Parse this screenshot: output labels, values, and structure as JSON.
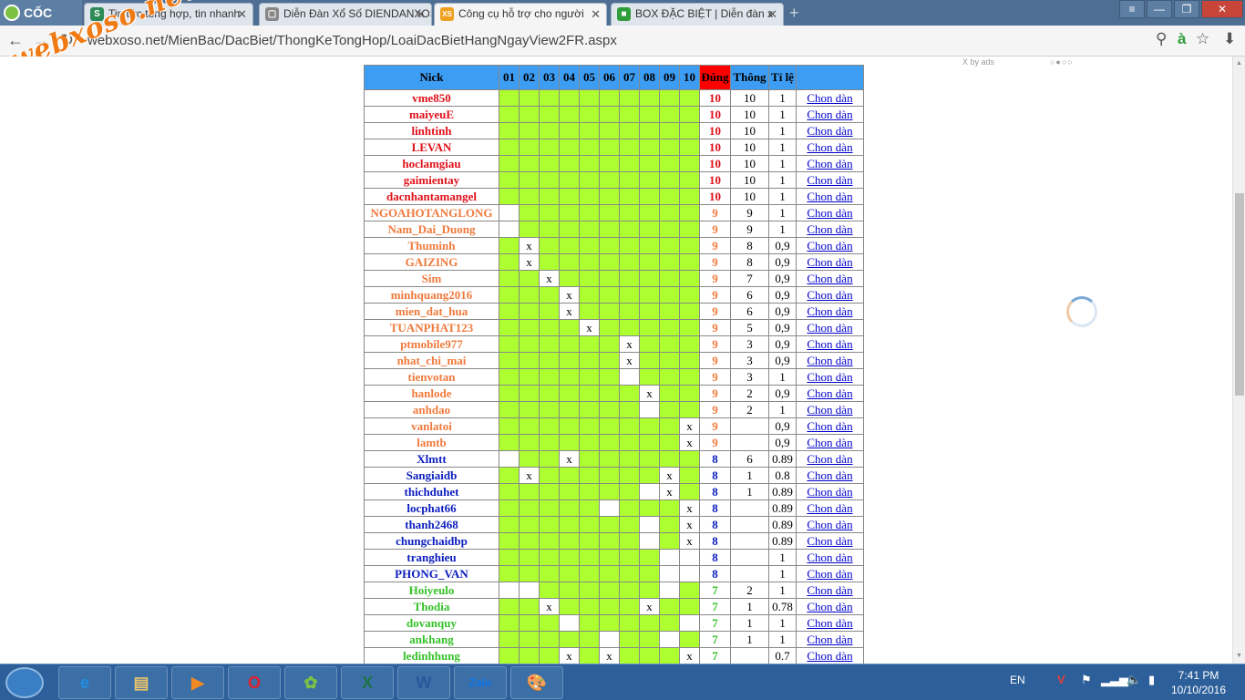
{
  "browser": {
    "logo_text": "CỐC CỐC",
    "tabs": [
      {
        "label": "Tin tức tổng hợp, tin nhanh",
        "favicon": "S",
        "favicon_color": "#2e8b57"
      },
      {
        "label": "Diễn Đàn Xổ Số DIENDANXOSO",
        "favicon": "▢",
        "favicon_color": "#888888"
      },
      {
        "label": "Công cụ hỗ trợ cho người",
        "favicon": "XS",
        "favicon_color": "#f0a020"
      },
      {
        "label": "BOX ĐẶC BIỆT | Diễn đàn x",
        "favicon": "■",
        "favicon_color": "#2e9d3a"
      }
    ],
    "new_tab": "+",
    "window_buttons": {
      "menu": "≡",
      "minimize": "—",
      "restore": "❐",
      "close": "✕"
    },
    "url": "http://webxoso.net/MienBac/DacBiet/ThongKeTongHop/LoaiDacBietHangNgayView2FR.aspx",
    "url_display": "webxoso.net/MienBac/DacBiet/ThongKeTongHop/LoaiDacBietHangNgayView2FR.aspx",
    "nav": {
      "back": "←",
      "forward": "→",
      "reload": "↻"
    },
    "toolbar_icons": {
      "search": "⚲",
      "translate": "à",
      "star": "☆",
      "download": "⬇"
    }
  },
  "watermark": "webxoso.net",
  "ads": {
    "label": "X by ads",
    "dots": "○●○○"
  },
  "table": {
    "headers": {
      "nick": "Nick",
      "days": [
        "01",
        "02",
        "03",
        "04",
        "05",
        "06",
        "07",
        "08",
        "09",
        "10"
      ],
      "dung": "Đúng",
      "thong": "Thông",
      "tile": "Tỉ lệ",
      "chon": ""
    },
    "colors": {
      "red": "#e0101a",
      "orange": "#f07a3c",
      "blue": "#0b1dbe",
      "green": "#35c128",
      "grid_green": "#adff2f",
      "header_blue": "#3d9df3",
      "header_red": "#ff0000"
    },
    "rows": [
      {
        "nick": "vme850",
        "color": "red",
        "off": [],
        "x": [],
        "dung": "10",
        "thong": "10",
        "tile": "1",
        "chon": "Chon dàn"
      },
      {
        "nick": "maiyeuE",
        "color": "red",
        "off": [],
        "x": [],
        "dung": "10",
        "thong": "10",
        "tile": "1",
        "chon": "Chon dàn"
      },
      {
        "nick": "linhtinh",
        "color": "red",
        "off": [],
        "x": [],
        "dung": "10",
        "thong": "10",
        "tile": "1",
        "chon": "Chon dàn"
      },
      {
        "nick": "LEVAN",
        "color": "red",
        "off": [],
        "x": [],
        "dung": "10",
        "thong": "10",
        "tile": "1",
        "chon": "Chon dàn"
      },
      {
        "nick": "hoclamgiau",
        "color": "red",
        "off": [],
        "x": [],
        "dung": "10",
        "thong": "10",
        "tile": "1",
        "chon": "Chon dàn"
      },
      {
        "nick": "gaimientay",
        "color": "red",
        "off": [],
        "x": [],
        "dung": "10",
        "thong": "10",
        "tile": "1",
        "chon": "Chon dàn"
      },
      {
        "nick": "dacnhantamangel",
        "color": "red",
        "off": [],
        "x": [],
        "dung": "10",
        "thong": "10",
        "tile": "1",
        "chon": "Chon dàn"
      },
      {
        "nick": "NGOAHOTANGLONG",
        "color": "orange",
        "off": [
          0
        ],
        "x": [],
        "dung": "9",
        "thong": "9",
        "tile": "1",
        "chon": "Chon dàn"
      },
      {
        "nick": "Nam_Dai_Duong",
        "color": "orange",
        "off": [
          0
        ],
        "x": [],
        "dung": "9",
        "thong": "9",
        "tile": "1",
        "chon": "Chon dàn"
      },
      {
        "nick": "Thuminh",
        "color": "orange",
        "off": [],
        "x": [
          1
        ],
        "dung": "9",
        "thong": "8",
        "tile": "0,9",
        "chon": "Chon dàn"
      },
      {
        "nick": "GAIZING",
        "color": "orange",
        "off": [],
        "x": [
          1
        ],
        "dung": "9",
        "thong": "8",
        "tile": "0,9",
        "chon": "Chon dàn"
      },
      {
        "nick": "Sim",
        "color": "orange",
        "off": [],
        "x": [
          2
        ],
        "dung": "9",
        "thong": "7",
        "tile": "0,9",
        "chon": "Chon dàn"
      },
      {
        "nick": "minhquang2016",
        "color": "orange",
        "off": [],
        "x": [
          3
        ],
        "dung": "9",
        "thong": "6",
        "tile": "0,9",
        "chon": "Chon dàn"
      },
      {
        "nick": "mien_dat_hua",
        "color": "orange",
        "off": [],
        "x": [
          3
        ],
        "dung": "9",
        "thong": "6",
        "tile": "0,9",
        "chon": "Chon dàn"
      },
      {
        "nick": "TUANPHAT123",
        "color": "orange",
        "off": [],
        "x": [
          4
        ],
        "dung": "9",
        "thong": "5",
        "tile": "0,9",
        "chon": "Chon dàn"
      },
      {
        "nick": "ptmobile977",
        "color": "orange",
        "off": [],
        "x": [
          6
        ],
        "dung": "9",
        "thong": "3",
        "tile": "0,9",
        "chon": "Chon dàn"
      },
      {
        "nick": "nhat_chi_mai",
        "color": "orange",
        "off": [],
        "x": [
          6
        ],
        "dung": "9",
        "thong": "3",
        "tile": "0,9",
        "chon": "Chon dàn"
      },
      {
        "nick": "tienvotan",
        "color": "orange",
        "off": [
          6
        ],
        "x": [],
        "dung": "9",
        "thong": "3",
        "tile": "1",
        "chon": "Chon dàn"
      },
      {
        "nick": "hanlode",
        "color": "orange",
        "off": [],
        "x": [
          7
        ],
        "dung": "9",
        "thong": "2",
        "tile": "0,9",
        "chon": "Chon dàn"
      },
      {
        "nick": "anhdao",
        "color": "orange",
        "off": [
          7
        ],
        "x": [],
        "dung": "9",
        "thong": "2",
        "tile": "1",
        "chon": "Chon dàn"
      },
      {
        "nick": "vanlatoi",
        "color": "orange",
        "off": [],
        "x": [
          9
        ],
        "dung": "9",
        "thong": "",
        "tile": "0,9",
        "chon": "Chon dàn"
      },
      {
        "nick": "lamtb",
        "color": "orange",
        "off": [],
        "x": [
          9
        ],
        "dung": "9",
        "thong": "",
        "tile": "0,9",
        "chon": "Chon dàn"
      },
      {
        "nick": "Xlmtt",
        "color": "blue",
        "off": [
          0
        ],
        "x": [
          3
        ],
        "dung": "8",
        "thong": "6",
        "tile": "0.89",
        "chon": "Chon dàn"
      },
      {
        "nick": "Sangiaidb",
        "color": "blue",
        "off": [],
        "x": [
          1,
          8
        ],
        "dung": "8",
        "thong": "1",
        "tile": "0.8",
        "chon": "Chon dàn"
      },
      {
        "nick": "thichduhet",
        "color": "blue",
        "off": [
          7
        ],
        "x": [
          8
        ],
        "dung": "8",
        "thong": "1",
        "tile": "0.89",
        "chon": "Chon dàn"
      },
      {
        "nick": "locphat66",
        "color": "blue",
        "off": [
          5
        ],
        "x": [
          9
        ],
        "dung": "8",
        "thong": "",
        "tile": "0.89",
        "chon": "Chon dàn"
      },
      {
        "nick": "thanh2468",
        "color": "blue",
        "off": [
          7
        ],
        "x": [
          9
        ],
        "dung": "8",
        "thong": "",
        "tile": "0.89",
        "chon": "Chon dàn"
      },
      {
        "nick": "chungchaidbp",
        "color": "blue",
        "off": [
          7
        ],
        "x": [
          9
        ],
        "dung": "8",
        "thong": "",
        "tile": "0.89",
        "chon": "Chon dàn"
      },
      {
        "nick": "tranghieu",
        "color": "blue",
        "off": [
          8,
          9
        ],
        "x": [],
        "dung": "8",
        "thong": "",
        "tile": "1",
        "chon": "Chon dàn"
      },
      {
        "nick": "PHONG_VAN",
        "color": "blue",
        "off": [
          8,
          9
        ],
        "x": [],
        "dung": "8",
        "thong": "",
        "tile": "1",
        "chon": "Chon dàn"
      },
      {
        "nick": "Hoiyeulo",
        "color": "green",
        "off": [
          0,
          1,
          8
        ],
        "x": [],
        "dung": "7",
        "thong": "2",
        "tile": "1",
        "chon": "Chon dàn"
      },
      {
        "nick": "Thodia",
        "color": "green",
        "off": [],
        "x": [
          2,
          7
        ],
        "dung": "7",
        "thong": "1",
        "tile": "0.78",
        "chon": "Chon dàn"
      },
      {
        "nick": "dovanquy",
        "color": "green",
        "off": [
          3,
          9
        ],
        "x": [],
        "dung": "7",
        "thong": "1",
        "tile": "1",
        "chon": "Chon dàn"
      },
      {
        "nick": "ankhang",
        "color": "green",
        "off": [
          5,
          8
        ],
        "x": [],
        "dung": "7",
        "thong": "1",
        "tile": "1",
        "chon": "Chon dàn"
      },
      {
        "nick": "ledinhhung",
        "color": "green",
        "off": [],
        "x": [
          3,
          5,
          9
        ],
        "dung": "7",
        "thong": "",
        "tile": "0.7",
        "chon": "Chon dàn"
      }
    ]
  },
  "taskbar": {
    "apps": [
      {
        "name": "ie",
        "glyph": "e",
        "color": "#1f8fe5"
      },
      {
        "name": "explorer",
        "glyph": "▤",
        "color": "#e9c46a"
      },
      {
        "name": "media-player",
        "glyph": "▶",
        "color": "#f08a24"
      },
      {
        "name": "opera",
        "glyph": "O",
        "color": "#e0202a"
      },
      {
        "name": "coccoc",
        "glyph": "✿",
        "color": "#7bc142"
      },
      {
        "name": "excel",
        "glyph": "X",
        "color": "#1e7145"
      },
      {
        "name": "word",
        "glyph": "W",
        "color": "#2b579a"
      },
      {
        "name": "zalo",
        "glyph": "Zalo",
        "color": "#0a74e8"
      },
      {
        "name": "paint",
        "glyph": "🎨",
        "color": "#d9a441"
      }
    ],
    "language": "EN",
    "clock_time": "7:41 PM",
    "clock_date": "10/10/2016"
  }
}
